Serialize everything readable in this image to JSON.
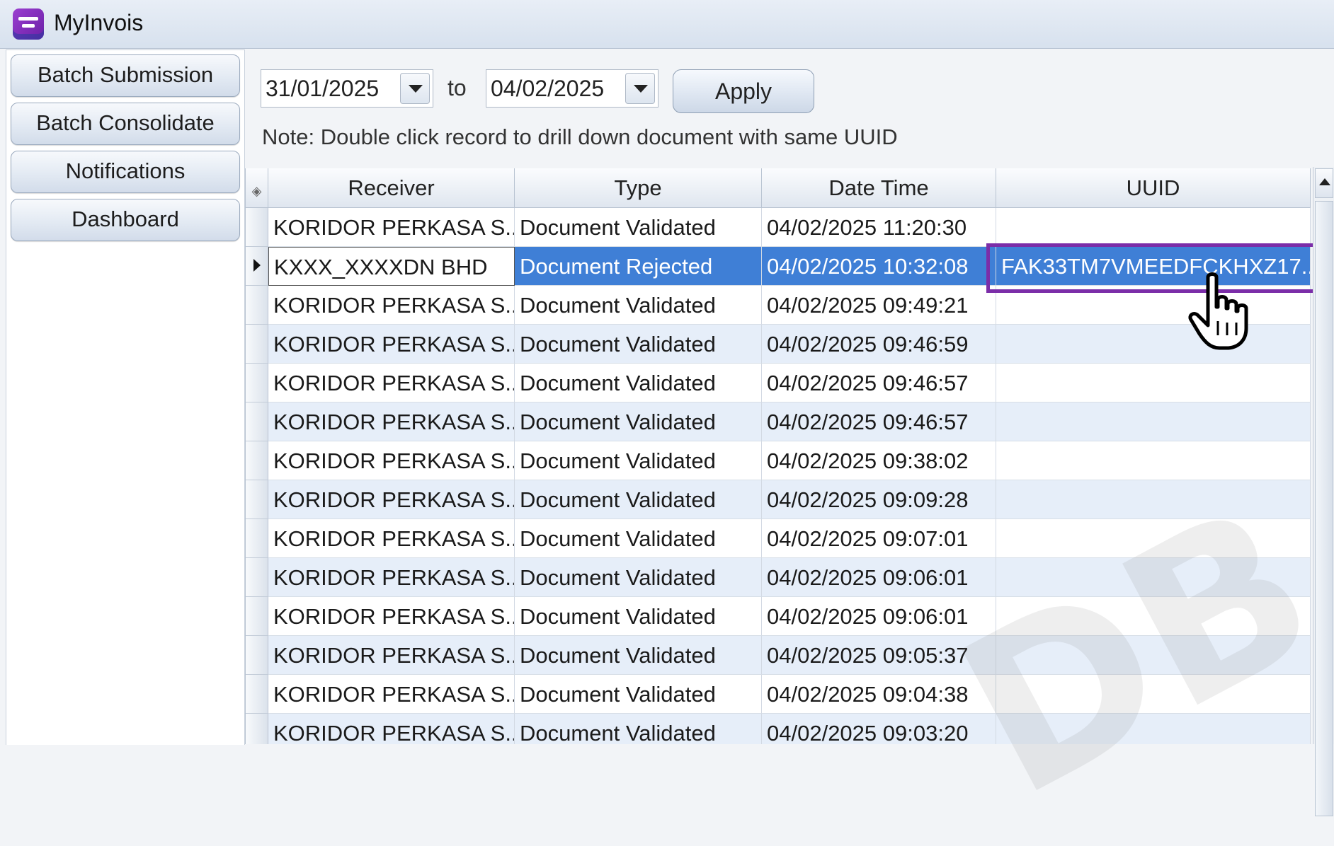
{
  "window": {
    "title": "MyInvois"
  },
  "nav": {
    "items": [
      "Batch Submission",
      "Batch Consolidate",
      "Notifications",
      "Dashboard"
    ]
  },
  "filter": {
    "from_date": "31/01/2025",
    "to_label": "to",
    "to_date": "04/02/2025",
    "apply_label": "Apply"
  },
  "note": "Note: Double click record to drill down document with same UUID",
  "grid": {
    "columns": [
      "Receiver",
      "Type",
      "Date Time",
      "UUID"
    ],
    "rows": [
      {
        "receiver": "KORIDOR PERKASA S...",
        "type": "Document Validated",
        "datetime": "04/02/2025 11:20:30",
        "uuid": ""
      },
      {
        "receiver": "KXXX_XXXXDN BHD",
        "type": "Document Rejected",
        "datetime": "04/02/2025 10:32:08",
        "uuid": "FAK33TM7VMEEDFCKHXZ17..."
      },
      {
        "receiver": "KORIDOR PERKASA S...",
        "type": "Document Validated",
        "datetime": "04/02/2025 09:49:21",
        "uuid": ""
      },
      {
        "receiver": "KORIDOR PERKASA S...",
        "type": "Document Validated",
        "datetime": "04/02/2025 09:46:59",
        "uuid": ""
      },
      {
        "receiver": "KORIDOR PERKASA S...",
        "type": "Document Validated",
        "datetime": "04/02/2025 09:46:57",
        "uuid": ""
      },
      {
        "receiver": "KORIDOR PERKASA S...",
        "type": "Document Validated",
        "datetime": "04/02/2025 09:46:57",
        "uuid": ""
      },
      {
        "receiver": "KORIDOR PERKASA S...",
        "type": "Document Validated",
        "datetime": "04/02/2025 09:38:02",
        "uuid": ""
      },
      {
        "receiver": "KORIDOR PERKASA S...",
        "type": "Document Validated",
        "datetime": "04/02/2025 09:09:28",
        "uuid": ""
      },
      {
        "receiver": "KORIDOR PERKASA S...",
        "type": "Document Validated",
        "datetime": "04/02/2025 09:07:01",
        "uuid": ""
      },
      {
        "receiver": "KORIDOR PERKASA S...",
        "type": "Document Validated",
        "datetime": "04/02/2025 09:06:01",
        "uuid": ""
      },
      {
        "receiver": "KORIDOR PERKASA S...",
        "type": "Document Validated",
        "datetime": "04/02/2025 09:06:01",
        "uuid": ""
      },
      {
        "receiver": "KORIDOR PERKASA S...",
        "type": "Document Validated",
        "datetime": "04/02/2025 09:05:37",
        "uuid": ""
      },
      {
        "receiver": "KORIDOR PERKASA S...",
        "type": "Document Validated",
        "datetime": "04/02/2025 09:04:38",
        "uuid": ""
      },
      {
        "receiver": "KORIDOR PERKASA S...",
        "type": "Document Validated",
        "datetime": "04/02/2025 09:03:20",
        "uuid": ""
      }
    ],
    "selected_row": 1
  },
  "icons": {
    "app": "myinvois-app-icon",
    "cursor": "hand-pointer-icon"
  },
  "colors": {
    "selection": "#3f7fd6",
    "highlight_border": "#7b2da8",
    "alt_row": "#e6eef9"
  }
}
